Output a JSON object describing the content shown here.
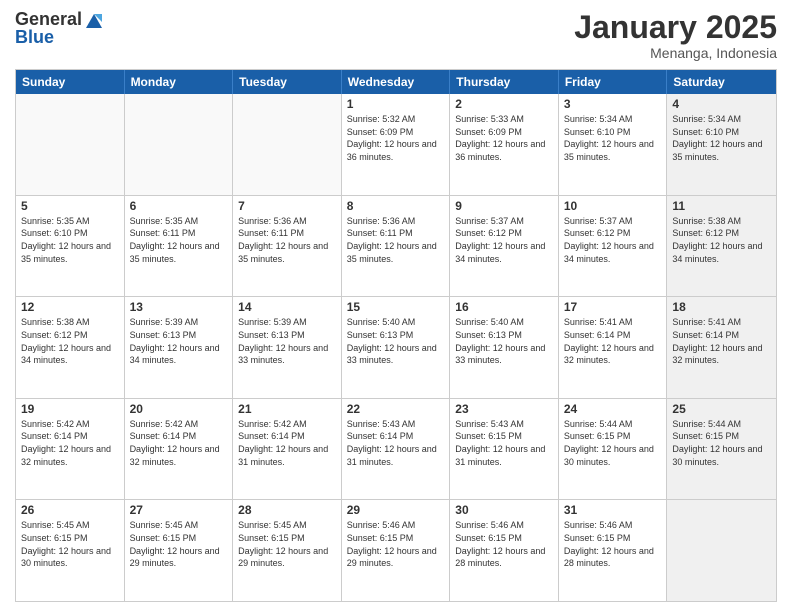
{
  "logo": {
    "text_general": "General",
    "text_blue": "Blue"
  },
  "title": "January 2025",
  "subtitle": "Menanga, Indonesia",
  "headers": [
    "Sunday",
    "Monday",
    "Tuesday",
    "Wednesday",
    "Thursday",
    "Friday",
    "Saturday"
  ],
  "rows": [
    [
      {
        "day": "",
        "info": "",
        "empty": true
      },
      {
        "day": "",
        "info": "",
        "empty": true
      },
      {
        "day": "",
        "info": "",
        "empty": true
      },
      {
        "day": "1",
        "info": "Sunrise: 5:32 AM\nSunset: 6:09 PM\nDaylight: 12 hours and 36 minutes.",
        "empty": false
      },
      {
        "day": "2",
        "info": "Sunrise: 5:33 AM\nSunset: 6:09 PM\nDaylight: 12 hours and 36 minutes.",
        "empty": false
      },
      {
        "day": "3",
        "info": "Sunrise: 5:34 AM\nSunset: 6:10 PM\nDaylight: 12 hours and 35 minutes.",
        "empty": false
      },
      {
        "day": "4",
        "info": "Sunrise: 5:34 AM\nSunset: 6:10 PM\nDaylight: 12 hours and 35 minutes.",
        "empty": false,
        "shaded": true
      }
    ],
    [
      {
        "day": "5",
        "info": "Sunrise: 5:35 AM\nSunset: 6:10 PM\nDaylight: 12 hours and 35 minutes.",
        "empty": false
      },
      {
        "day": "6",
        "info": "Sunrise: 5:35 AM\nSunset: 6:11 PM\nDaylight: 12 hours and 35 minutes.",
        "empty": false
      },
      {
        "day": "7",
        "info": "Sunrise: 5:36 AM\nSunset: 6:11 PM\nDaylight: 12 hours and 35 minutes.",
        "empty": false
      },
      {
        "day": "8",
        "info": "Sunrise: 5:36 AM\nSunset: 6:11 PM\nDaylight: 12 hours and 35 minutes.",
        "empty": false
      },
      {
        "day": "9",
        "info": "Sunrise: 5:37 AM\nSunset: 6:12 PM\nDaylight: 12 hours and 34 minutes.",
        "empty": false
      },
      {
        "day": "10",
        "info": "Sunrise: 5:37 AM\nSunset: 6:12 PM\nDaylight: 12 hours and 34 minutes.",
        "empty": false
      },
      {
        "day": "11",
        "info": "Sunrise: 5:38 AM\nSunset: 6:12 PM\nDaylight: 12 hours and 34 minutes.",
        "empty": false,
        "shaded": true
      }
    ],
    [
      {
        "day": "12",
        "info": "Sunrise: 5:38 AM\nSunset: 6:12 PM\nDaylight: 12 hours and 34 minutes.",
        "empty": false
      },
      {
        "day": "13",
        "info": "Sunrise: 5:39 AM\nSunset: 6:13 PM\nDaylight: 12 hours and 34 minutes.",
        "empty": false
      },
      {
        "day": "14",
        "info": "Sunrise: 5:39 AM\nSunset: 6:13 PM\nDaylight: 12 hours and 33 minutes.",
        "empty": false
      },
      {
        "day": "15",
        "info": "Sunrise: 5:40 AM\nSunset: 6:13 PM\nDaylight: 12 hours and 33 minutes.",
        "empty": false
      },
      {
        "day": "16",
        "info": "Sunrise: 5:40 AM\nSunset: 6:13 PM\nDaylight: 12 hours and 33 minutes.",
        "empty": false
      },
      {
        "day": "17",
        "info": "Sunrise: 5:41 AM\nSunset: 6:14 PM\nDaylight: 12 hours and 32 minutes.",
        "empty": false
      },
      {
        "day": "18",
        "info": "Sunrise: 5:41 AM\nSunset: 6:14 PM\nDaylight: 12 hours and 32 minutes.",
        "empty": false,
        "shaded": true
      }
    ],
    [
      {
        "day": "19",
        "info": "Sunrise: 5:42 AM\nSunset: 6:14 PM\nDaylight: 12 hours and 32 minutes.",
        "empty": false
      },
      {
        "day": "20",
        "info": "Sunrise: 5:42 AM\nSunset: 6:14 PM\nDaylight: 12 hours and 32 minutes.",
        "empty": false
      },
      {
        "day": "21",
        "info": "Sunrise: 5:42 AM\nSunset: 6:14 PM\nDaylight: 12 hours and 31 minutes.",
        "empty": false
      },
      {
        "day": "22",
        "info": "Sunrise: 5:43 AM\nSunset: 6:14 PM\nDaylight: 12 hours and 31 minutes.",
        "empty": false
      },
      {
        "day": "23",
        "info": "Sunrise: 5:43 AM\nSunset: 6:15 PM\nDaylight: 12 hours and 31 minutes.",
        "empty": false
      },
      {
        "day": "24",
        "info": "Sunrise: 5:44 AM\nSunset: 6:15 PM\nDaylight: 12 hours and 30 minutes.",
        "empty": false
      },
      {
        "day": "25",
        "info": "Sunrise: 5:44 AM\nSunset: 6:15 PM\nDaylight: 12 hours and 30 minutes.",
        "empty": false,
        "shaded": true
      }
    ],
    [
      {
        "day": "26",
        "info": "Sunrise: 5:45 AM\nSunset: 6:15 PM\nDaylight: 12 hours and 30 minutes.",
        "empty": false
      },
      {
        "day": "27",
        "info": "Sunrise: 5:45 AM\nSunset: 6:15 PM\nDaylight: 12 hours and 29 minutes.",
        "empty": false
      },
      {
        "day": "28",
        "info": "Sunrise: 5:45 AM\nSunset: 6:15 PM\nDaylight: 12 hours and 29 minutes.",
        "empty": false
      },
      {
        "day": "29",
        "info": "Sunrise: 5:46 AM\nSunset: 6:15 PM\nDaylight: 12 hours and 29 minutes.",
        "empty": false
      },
      {
        "day": "30",
        "info": "Sunrise: 5:46 AM\nSunset: 6:15 PM\nDaylight: 12 hours and 28 minutes.",
        "empty": false
      },
      {
        "day": "31",
        "info": "Sunrise: 5:46 AM\nSunset: 6:15 PM\nDaylight: 12 hours and 28 minutes.",
        "empty": false
      },
      {
        "day": "",
        "info": "",
        "empty": true,
        "shaded": true
      }
    ]
  ]
}
